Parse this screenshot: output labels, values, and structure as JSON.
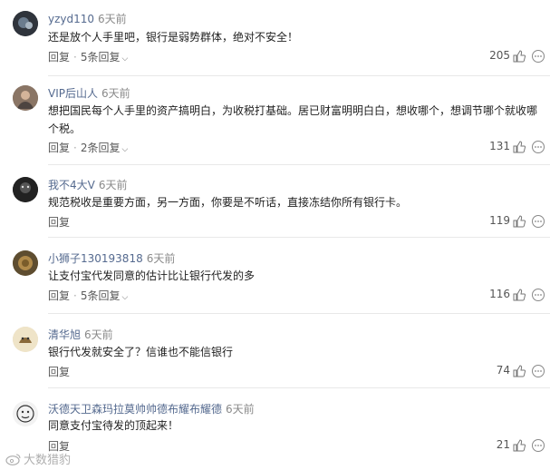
{
  "comments": [
    {
      "username": "yzyd110",
      "time": "6天前",
      "text": "还是放个人手里吧，银行是弱势群体，绝对不安全！",
      "reply_label": "回复",
      "replies_label": "5条回复",
      "likes": "205"
    },
    {
      "username": "VIP后山人",
      "time": "6天前",
      "text": "想把国民每个人手里的资产搞明白，为收税打基础。居已财富明明白白，想收哪个，想调节哪个就收哪个税。",
      "reply_label": "回复",
      "replies_label": "2条回复",
      "likes": "131"
    },
    {
      "username": "我不4大V",
      "time": "6天前",
      "text": "规范税收是重要方面，另一方面，你要是不听话，直接冻结你所有银行卡。",
      "reply_label": "回复",
      "replies_label": "",
      "likes": "119"
    },
    {
      "username": "小狮子130193818",
      "time": "6天前",
      "text": "让支付宝代发同意的估计比让银行代发的多",
      "reply_label": "回复",
      "replies_label": "5条回复",
      "likes": "116"
    },
    {
      "username": "清华旭",
      "time": "6天前",
      "text": "银行代发就安全了？信谁也不能信银行",
      "reply_label": "回复",
      "replies_label": "",
      "likes": "74"
    },
    {
      "username": "沃德天卫森玛拉莫帅帅德布耀布耀德",
      "time": "6天前",
      "text": "同意支付宝待发的顶起来！",
      "reply_label": "回复",
      "replies_label": "",
      "likes": "21"
    }
  ],
  "watermark": "大数猎豹",
  "icons": {
    "like": "thumbs-up-icon",
    "more": "more-options-icon",
    "chevron": "chevron-down-icon"
  },
  "colors": {
    "username": "#556a8f",
    "time": "#8a8a8a",
    "divider": "#e8e8e8"
  }
}
